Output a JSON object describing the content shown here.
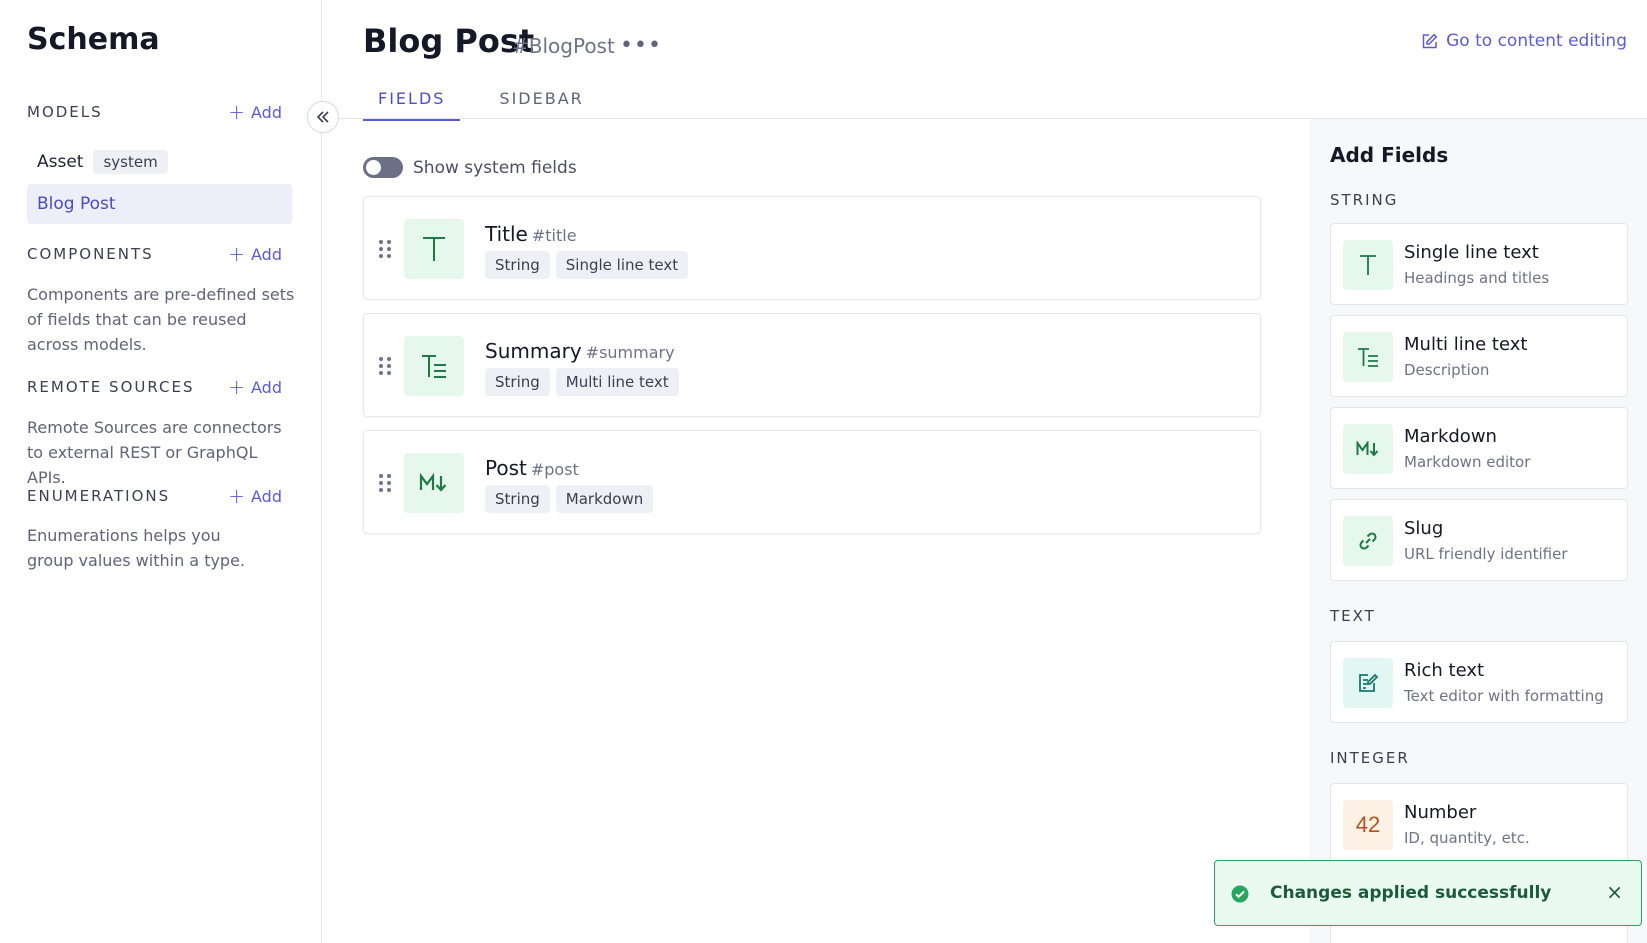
{
  "sidebar": {
    "title": "Schema",
    "models": {
      "title": "MODELS",
      "add_label": "Add",
      "items": [
        {
          "label": "Asset",
          "badge": "system"
        },
        {
          "label": "Blog Post"
        }
      ]
    },
    "components": {
      "title": "COMPONENTS",
      "add_label": "Add",
      "description": "Components are pre-defined sets of fields that can be reused across models."
    },
    "remote_sources": {
      "title": "REMOTE SOURCES",
      "add_label": "Add",
      "description": "Remote Sources are connectors to external REST or GraphQL APIs."
    },
    "enumerations": {
      "title": "ENUMERATIONS",
      "add_label": "Add",
      "description": "Enumerations helps you group values within a type."
    }
  },
  "header": {
    "title": "Blog Post",
    "api_id": "#BlogPost",
    "more": "•••",
    "goto_link": "Go to content editing"
  },
  "tabs": [
    {
      "label": "FIELDS",
      "active": true
    },
    {
      "label": "SIDEBAR",
      "active": false
    }
  ],
  "toggle": {
    "label": "Show system fields",
    "on": false
  },
  "fields": [
    {
      "name": "Title",
      "api_id": "#title",
      "tags": [
        "String",
        "Single line text"
      ],
      "icon": "single-line-text-icon"
    },
    {
      "name": "Summary",
      "api_id": "#summary",
      "tags": [
        "String",
        "Multi line text"
      ],
      "icon": "multi-line-text-icon"
    },
    {
      "name": "Post",
      "api_id": "#post",
      "tags": [
        "String",
        "Markdown"
      ],
      "icon": "markdown-icon"
    }
  ],
  "add_fields": {
    "title": "Add Fields",
    "groups": [
      {
        "title": "STRING",
        "items": [
          {
            "name": "Single line text",
            "desc": "Headings and titles",
            "icon": "T"
          },
          {
            "name": "Multi line text",
            "desc": "Description",
            "icon": "multi-line-icon"
          },
          {
            "name": "Markdown",
            "desc": "Markdown editor",
            "icon": "M↓"
          },
          {
            "name": "Slug",
            "desc": "URL friendly identifier",
            "icon": "link-icon"
          }
        ]
      },
      {
        "title": "TEXT",
        "items": [
          {
            "name": "Rich text",
            "desc": "Text editor with formatting",
            "icon": "rich-text-icon"
          }
        ]
      },
      {
        "title": "INTEGER",
        "items": [
          {
            "name": "Number",
            "desc": "ID, quantity, etc.",
            "icon": "42"
          }
        ]
      }
    ]
  },
  "toast": {
    "message": "Changes applied successfully",
    "close": "×"
  },
  "colors": {
    "accent": "#5b5bd6",
    "success": "#27a660",
    "icon_bg": "#e6f8ec",
    "icon_fg": "#1d7a45"
  }
}
